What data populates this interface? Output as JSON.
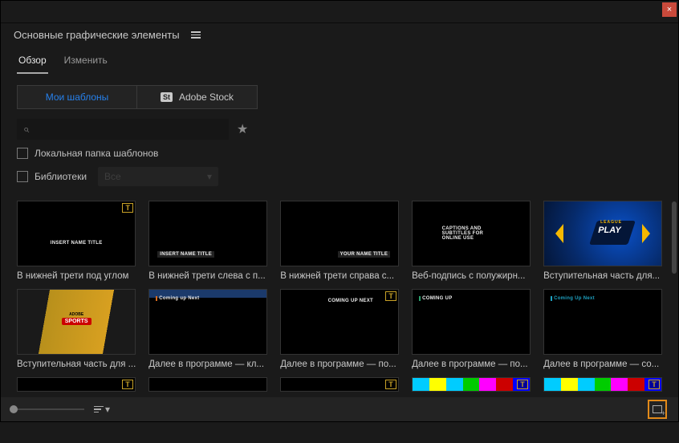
{
  "titlebar": {
    "close": "×"
  },
  "panel": {
    "title": "Основные графические элементы"
  },
  "tabs": {
    "overview": "Обзор",
    "edit": "Изменить"
  },
  "sources": {
    "my_templates": "Мои шаблоны",
    "stock_badge": "St",
    "stock": "Adobe Stock"
  },
  "search": {
    "placeholder": ""
  },
  "filters": {
    "local_label": "Локальная папка шаблонов",
    "libs_label": "Библиотеки",
    "libs_select": "Все"
  },
  "badge_glyph": "T",
  "thumbs": {
    "t1": "INSERT NAME TITLE",
    "t2": "INSERT NAME TITLE",
    "t3": "YOUR NAME TITLE",
    "t4": "CAPTIONS AND SUBTITLES FOR ONLINE USE",
    "t5_sub": "LEAGUE",
    "t5_txt": "PLAY",
    "t6_top": "ADOBE",
    "t6": "SPORTS",
    "t7": "Coming up Next",
    "t8": "COMING UP  NEXT",
    "t9": "COMING UP",
    "t10": "Coming Up Next"
  },
  "items": [
    {
      "caption": "В нижней трети под углом"
    },
    {
      "caption": "В нижней трети слева с п..."
    },
    {
      "caption": "В нижней трети справа с..."
    },
    {
      "caption": "Веб-подпись с полужирн..."
    },
    {
      "caption": "Вступительная часть для..."
    },
    {
      "caption": "Вступительная часть для ..."
    },
    {
      "caption": "Далее в программе — кл..."
    },
    {
      "caption": "Далее в программе — по..."
    },
    {
      "caption": "Далее в программе — по..."
    },
    {
      "caption": "Далее в программе — со..."
    }
  ],
  "footer": {
    "sort_caret": "▾"
  }
}
